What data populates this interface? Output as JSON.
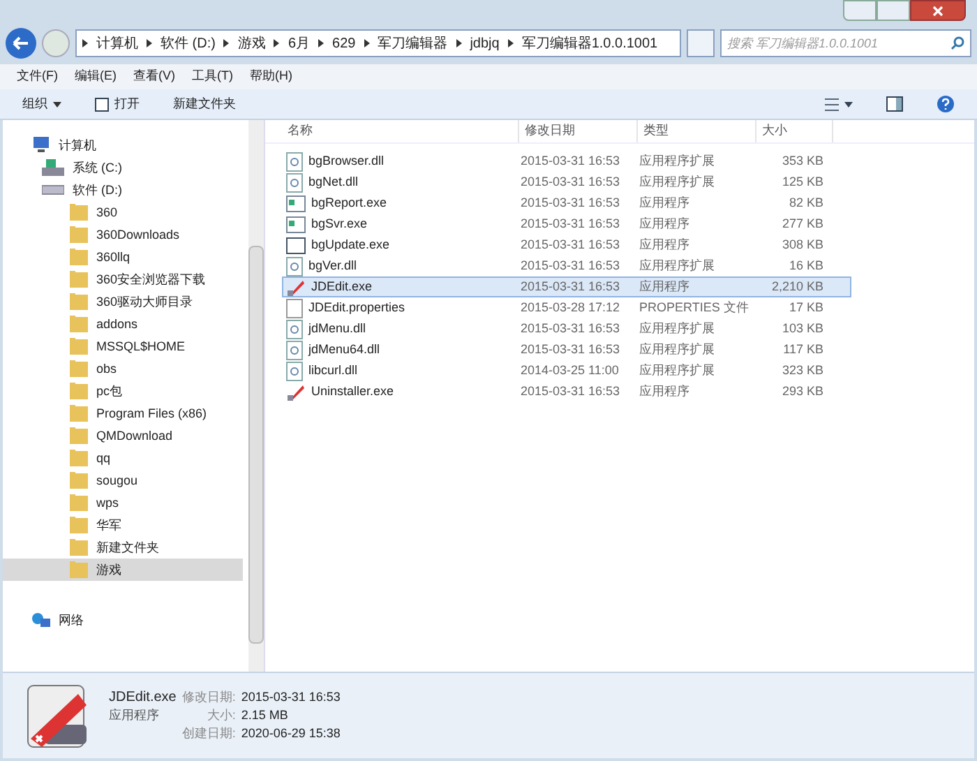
{
  "breadcrumb": [
    "计算机",
    "软件 (D:)",
    "游戏",
    "6月",
    "629",
    "军刀编辑器",
    "jdbjq",
    "军刀编辑器1.0.0.1001"
  ],
  "search": {
    "placeholder": "搜索 军刀编辑器1.0.0.1001"
  },
  "menu": [
    "文件(F)",
    "编辑(E)",
    "查看(V)",
    "工具(T)",
    "帮助(H)"
  ],
  "toolbar": [
    {
      "label": "组织",
      "kind": "dropdown"
    },
    {
      "label": "打开",
      "kind": "open"
    },
    {
      "label": "新建文件夹",
      "kind": "plain"
    }
  ],
  "nav": [
    {
      "label": "计算机",
      "kind": "computer",
      "selected": false,
      "children": [
        {
          "label": "系统 (C:)",
          "kind": "system-drive",
          "selected": false
        },
        {
          "label": "软件 (D:)",
          "kind": "drive",
          "selected": false,
          "children": [
            {
              "label": "360",
              "kind": "folder",
              "selected": false
            },
            {
              "label": "360Downloads",
              "kind": "folder",
              "selected": false
            },
            {
              "label": "360llq",
              "kind": "folder",
              "selected": false
            },
            {
              "label": "360安全浏览器下载",
              "kind": "folder",
              "selected": false
            },
            {
              "label": "360驱动大师目录",
              "kind": "folder",
              "selected": false
            },
            {
              "label": "addons",
              "kind": "folder",
              "selected": false
            },
            {
              "label": "MSSQL$HOME",
              "kind": "folder",
              "selected": false
            },
            {
              "label": "obs",
              "kind": "folder",
              "selected": false
            },
            {
              "label": "pc包",
              "kind": "folder",
              "selected": false
            },
            {
              "label": "Program Files (x86)",
              "kind": "folder",
              "selected": false
            },
            {
              "label": "QMDownload",
              "kind": "folder",
              "selected": false
            },
            {
              "label": "qq",
              "kind": "folder",
              "selected": false
            },
            {
              "label": "sougou",
              "kind": "folder",
              "selected": false
            },
            {
              "label": "wps",
              "kind": "folder",
              "selected": false
            },
            {
              "label": "华军",
              "kind": "folder",
              "selected": false
            },
            {
              "label": "新建文件夹",
              "kind": "folder",
              "selected": false
            },
            {
              "label": "游戏",
              "kind": "folder",
              "selected": true
            }
          ]
        }
      ]
    },
    {
      "label": "网络",
      "kind": "network",
      "selected": false
    }
  ],
  "columns": [
    "名称",
    "修改日期",
    "类型",
    "大小"
  ],
  "files": [
    {
      "name": "bgBrowser.dll",
      "date": "2015-03-31 16:53",
      "type": "应用程序扩展",
      "size": "353 KB",
      "kind": "dll",
      "selected": false
    },
    {
      "name": "bgNet.dll",
      "date": "2015-03-31 16:53",
      "type": "应用程序扩展",
      "size": "125 KB",
      "kind": "dll",
      "selected": false
    },
    {
      "name": "bgReport.exe",
      "date": "2015-03-31 16:53",
      "type": "应用程序",
      "size": "82 KB",
      "kind": "exe",
      "selected": false
    },
    {
      "name": "bgSvr.exe",
      "date": "2015-03-31 16:53",
      "type": "应用程序",
      "size": "277 KB",
      "kind": "exe",
      "selected": false
    },
    {
      "name": "bgUpdate.exe",
      "date": "2015-03-31 16:53",
      "type": "应用程序",
      "size": "308 KB",
      "kind": "window",
      "selected": false
    },
    {
      "name": "bgVer.dll",
      "date": "2015-03-31 16:53",
      "type": "应用程序扩展",
      "size": "16 KB",
      "kind": "dll",
      "selected": false
    },
    {
      "name": "JDEdit.exe",
      "date": "2015-03-31 16:53",
      "type": "应用程序",
      "size": "2,210 KB",
      "kind": "red",
      "selected": true
    },
    {
      "name": "JDEdit.properties",
      "date": "2015-03-28 17:12",
      "type": "PROPERTIES 文件",
      "size": "17 KB",
      "kind": "doc",
      "selected": false
    },
    {
      "name": "jdMenu.dll",
      "date": "2015-03-31 16:53",
      "type": "应用程序扩展",
      "size": "103 KB",
      "kind": "dll",
      "selected": false
    },
    {
      "name": "jdMenu64.dll",
      "date": "2015-03-31 16:53",
      "type": "应用程序扩展",
      "size": "117 KB",
      "kind": "dll",
      "selected": false
    },
    {
      "name": "libcurl.dll",
      "date": "2014-03-25 11:00",
      "type": "应用程序扩展",
      "size": "323 KB",
      "kind": "dll",
      "selected": false
    },
    {
      "name": "Uninstaller.exe",
      "date": "2015-03-31 16:53",
      "type": "应用程序",
      "size": "293 KB",
      "kind": "red",
      "selected": false
    }
  ],
  "details": {
    "name": "JDEdit.exe",
    "type": "应用程序",
    "fields": [
      {
        "label": "修改日期:",
        "value": "2015-03-31 16:53"
      },
      {
        "label": "大小:",
        "value": "2.15 MB"
      },
      {
        "label": "创建日期:",
        "value": "2020-06-29 15:38"
      }
    ]
  }
}
